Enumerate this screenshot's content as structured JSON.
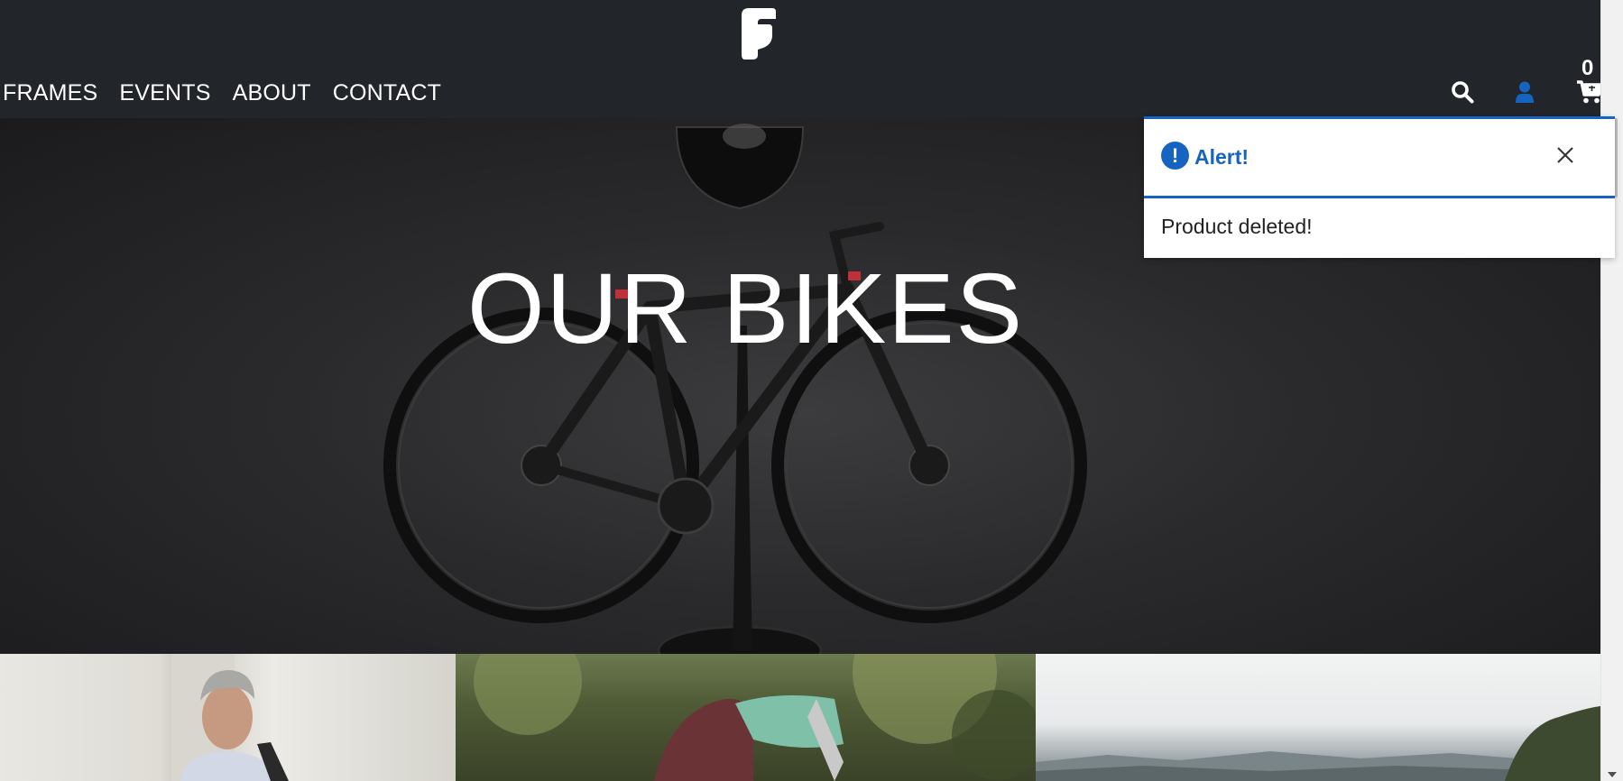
{
  "nav": {
    "items": [
      {
        "label": "FRAMES"
      },
      {
        "label": "EVENTS"
      },
      {
        "label": "ABOUT"
      },
      {
        "label": "CONTACT"
      }
    ]
  },
  "header": {
    "cart_count": "0",
    "icons": [
      "logo",
      "search-icon",
      "user-icon",
      "cart-icon"
    ],
    "background": "#22252a",
    "accent": "#1565c0"
  },
  "hero": {
    "title": "OUR BIKES"
  },
  "toast": {
    "title": "Alert!",
    "message": "Product deleted!",
    "icon": "exclamation-icon",
    "color": "#1565c0"
  }
}
